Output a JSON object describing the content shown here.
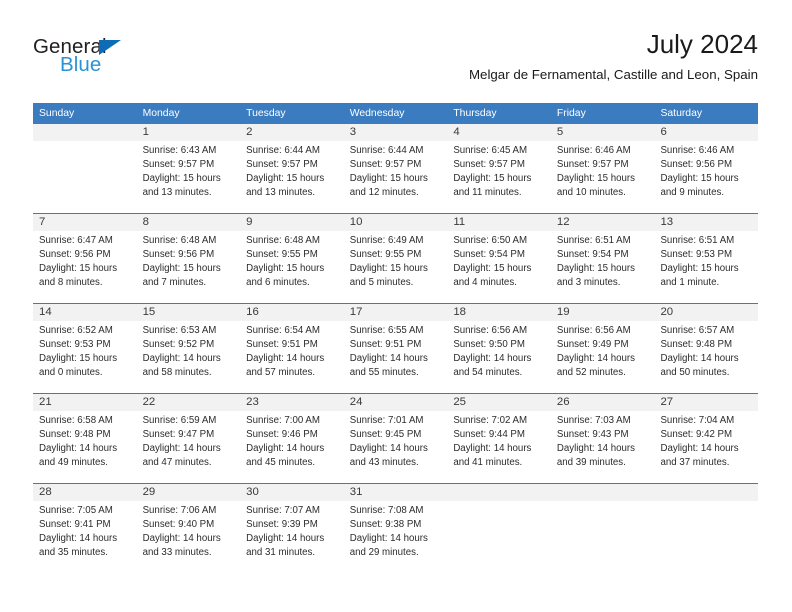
{
  "brand": {
    "name_part1": "General",
    "name_part2": "Blue",
    "triangle_color": "#0d6cb6",
    "blue_color": "#2b93d4"
  },
  "header": {
    "title": "July 2024",
    "subtitle": "Melgar de Fernamental, Castille and Leon, Spain"
  },
  "theme": {
    "header_blue": "#3b7cc0",
    "daynum_band": "#f2f2f2",
    "text": "#2c2c2c"
  },
  "calendar": {
    "weekdays": [
      "Sunday",
      "Monday",
      "Tuesday",
      "Wednesday",
      "Thursday",
      "Friday",
      "Saturday"
    ],
    "weeks": [
      [
        {
          "day": "",
          "lines": [
            "",
            "",
            "",
            ""
          ]
        },
        {
          "day": "1",
          "lines": [
            "Sunrise: 6:43 AM",
            "Sunset: 9:57 PM",
            "Daylight: 15 hours",
            "and 13 minutes."
          ]
        },
        {
          "day": "2",
          "lines": [
            "Sunrise: 6:44 AM",
            "Sunset: 9:57 PM",
            "Daylight: 15 hours",
            "and 13 minutes."
          ]
        },
        {
          "day": "3",
          "lines": [
            "Sunrise: 6:44 AM",
            "Sunset: 9:57 PM",
            "Daylight: 15 hours",
            "and 12 minutes."
          ]
        },
        {
          "day": "4",
          "lines": [
            "Sunrise: 6:45 AM",
            "Sunset: 9:57 PM",
            "Daylight: 15 hours",
            "and 11 minutes."
          ]
        },
        {
          "day": "5",
          "lines": [
            "Sunrise: 6:46 AM",
            "Sunset: 9:57 PM",
            "Daylight: 15 hours",
            "and 10 minutes."
          ]
        },
        {
          "day": "6",
          "lines": [
            "Sunrise: 6:46 AM",
            "Sunset: 9:56 PM",
            "Daylight: 15 hours",
            "and 9 minutes."
          ]
        }
      ],
      [
        {
          "day": "7",
          "lines": [
            "Sunrise: 6:47 AM",
            "Sunset: 9:56 PM",
            "Daylight: 15 hours",
            "and 8 minutes."
          ]
        },
        {
          "day": "8",
          "lines": [
            "Sunrise: 6:48 AM",
            "Sunset: 9:56 PM",
            "Daylight: 15 hours",
            "and 7 minutes."
          ]
        },
        {
          "day": "9",
          "lines": [
            "Sunrise: 6:48 AM",
            "Sunset: 9:55 PM",
            "Daylight: 15 hours",
            "and 6 minutes."
          ]
        },
        {
          "day": "10",
          "lines": [
            "Sunrise: 6:49 AM",
            "Sunset: 9:55 PM",
            "Daylight: 15 hours",
            "and 5 minutes."
          ]
        },
        {
          "day": "11",
          "lines": [
            "Sunrise: 6:50 AM",
            "Sunset: 9:54 PM",
            "Daylight: 15 hours",
            "and 4 minutes."
          ]
        },
        {
          "day": "12",
          "lines": [
            "Sunrise: 6:51 AM",
            "Sunset: 9:54 PM",
            "Daylight: 15 hours",
            "and 3 minutes."
          ]
        },
        {
          "day": "13",
          "lines": [
            "Sunrise: 6:51 AM",
            "Sunset: 9:53 PM",
            "Daylight: 15 hours",
            "and 1 minute."
          ]
        }
      ],
      [
        {
          "day": "14",
          "lines": [
            "Sunrise: 6:52 AM",
            "Sunset: 9:53 PM",
            "Daylight: 15 hours",
            "and 0 minutes."
          ]
        },
        {
          "day": "15",
          "lines": [
            "Sunrise: 6:53 AM",
            "Sunset: 9:52 PM",
            "Daylight: 14 hours",
            "and 58 minutes."
          ]
        },
        {
          "day": "16",
          "lines": [
            "Sunrise: 6:54 AM",
            "Sunset: 9:51 PM",
            "Daylight: 14 hours",
            "and 57 minutes."
          ]
        },
        {
          "day": "17",
          "lines": [
            "Sunrise: 6:55 AM",
            "Sunset: 9:51 PM",
            "Daylight: 14 hours",
            "and 55 minutes."
          ]
        },
        {
          "day": "18",
          "lines": [
            "Sunrise: 6:56 AM",
            "Sunset: 9:50 PM",
            "Daylight: 14 hours",
            "and 54 minutes."
          ]
        },
        {
          "day": "19",
          "lines": [
            "Sunrise: 6:56 AM",
            "Sunset: 9:49 PM",
            "Daylight: 14 hours",
            "and 52 minutes."
          ]
        },
        {
          "day": "20",
          "lines": [
            "Sunrise: 6:57 AM",
            "Sunset: 9:48 PM",
            "Daylight: 14 hours",
            "and 50 minutes."
          ]
        }
      ],
      [
        {
          "day": "21",
          "lines": [
            "Sunrise: 6:58 AM",
            "Sunset: 9:48 PM",
            "Daylight: 14 hours",
            "and 49 minutes."
          ]
        },
        {
          "day": "22",
          "lines": [
            "Sunrise: 6:59 AM",
            "Sunset: 9:47 PM",
            "Daylight: 14 hours",
            "and 47 minutes."
          ]
        },
        {
          "day": "23",
          "lines": [
            "Sunrise: 7:00 AM",
            "Sunset: 9:46 PM",
            "Daylight: 14 hours",
            "and 45 minutes."
          ]
        },
        {
          "day": "24",
          "lines": [
            "Sunrise: 7:01 AM",
            "Sunset: 9:45 PM",
            "Daylight: 14 hours",
            "and 43 minutes."
          ]
        },
        {
          "day": "25",
          "lines": [
            "Sunrise: 7:02 AM",
            "Sunset: 9:44 PM",
            "Daylight: 14 hours",
            "and 41 minutes."
          ]
        },
        {
          "day": "26",
          "lines": [
            "Sunrise: 7:03 AM",
            "Sunset: 9:43 PM",
            "Daylight: 14 hours",
            "and 39 minutes."
          ]
        },
        {
          "day": "27",
          "lines": [
            "Sunrise: 7:04 AM",
            "Sunset: 9:42 PM",
            "Daylight: 14 hours",
            "and 37 minutes."
          ]
        }
      ],
      [
        {
          "day": "28",
          "lines": [
            "Sunrise: 7:05 AM",
            "Sunset: 9:41 PM",
            "Daylight: 14 hours",
            "and 35 minutes."
          ]
        },
        {
          "day": "29",
          "lines": [
            "Sunrise: 7:06 AM",
            "Sunset: 9:40 PM",
            "Daylight: 14 hours",
            "and 33 minutes."
          ]
        },
        {
          "day": "30",
          "lines": [
            "Sunrise: 7:07 AM",
            "Sunset: 9:39 PM",
            "Daylight: 14 hours",
            "and 31 minutes."
          ]
        },
        {
          "day": "31",
          "lines": [
            "Sunrise: 7:08 AM",
            "Sunset: 9:38 PM",
            "Daylight: 14 hours",
            "and 29 minutes."
          ]
        },
        {
          "day": "",
          "lines": [
            "",
            "",
            "",
            ""
          ]
        },
        {
          "day": "",
          "lines": [
            "",
            "",
            "",
            ""
          ]
        },
        {
          "day": "",
          "lines": [
            "",
            "",
            "",
            ""
          ]
        }
      ]
    ]
  }
}
